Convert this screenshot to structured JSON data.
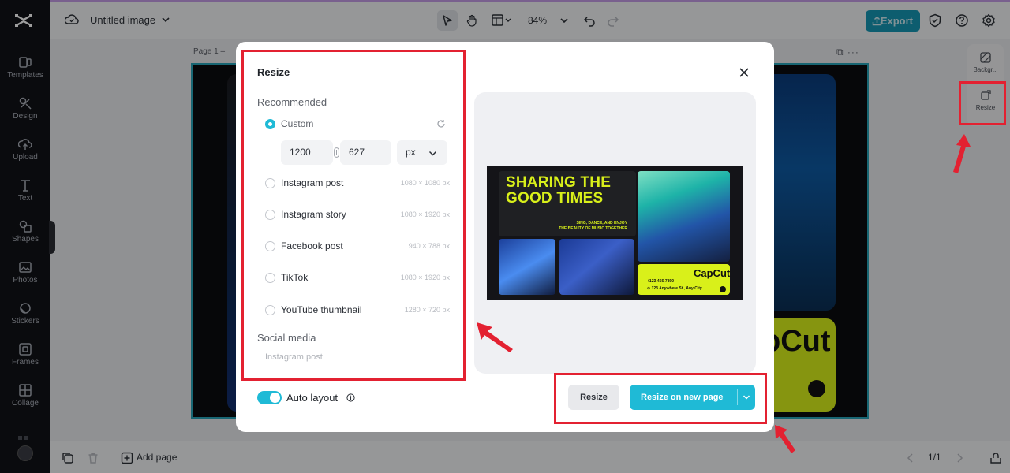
{
  "app": {
    "document_title": "Untitled image",
    "zoom": "84%",
    "export_label": "Export",
    "page_label": "Page 1 –",
    "page_options": "⧉ ···"
  },
  "sidebar": {
    "items": [
      {
        "label": "Templates",
        "icon": "templates-icon"
      },
      {
        "label": "Design",
        "icon": "design-icon"
      },
      {
        "label": "Upload",
        "icon": "upload-icon"
      },
      {
        "label": "Text",
        "icon": "text-icon"
      },
      {
        "label": "Shapes",
        "icon": "shapes-icon"
      },
      {
        "label": "Photos",
        "icon": "photos-icon"
      },
      {
        "label": "Stickers",
        "icon": "stickers-icon"
      },
      {
        "label": "Frames",
        "icon": "frames-icon"
      },
      {
        "label": "Collage",
        "icon": "collage-icon"
      }
    ]
  },
  "right_panel": {
    "items": [
      {
        "label": "Backgr...",
        "icon": "background-icon"
      },
      {
        "label": "Resize",
        "icon": "resize-icon"
      }
    ]
  },
  "bottom": {
    "add_page_label": "Add page",
    "page_count": "1/1"
  },
  "canvas_bg": {
    "brand": "pCut"
  },
  "modal": {
    "title": "Resize",
    "recommended_heading": "Recommended",
    "custom_label": "Custom",
    "width_value": "1200",
    "height_value": "627",
    "unit": "px",
    "options": [
      {
        "label": "Instagram post",
        "dims": "1080 × 1080 px"
      },
      {
        "label": "Instagram story",
        "dims": "1080 × 1920 px"
      },
      {
        "label": "Facebook post",
        "dims": "940 × 788 px"
      },
      {
        "label": "TikTok",
        "dims": "1080 × 1920 px"
      },
      {
        "label": "YouTube thumbnail",
        "dims": "1280 × 720 px"
      }
    ],
    "social_heading": "Social media",
    "social_first": "Instagram post",
    "auto_layout_label": "Auto layout",
    "auto_layout_on": true,
    "resize_button": "Resize",
    "resize_new_button": "Resize on new page",
    "preview": {
      "headline": "SHARING THE GOOD TIMES",
      "headline_line1": "SHARING THE",
      "headline_line2": "GOOD TIMES",
      "sub_line1": "SING, DANCE, AND ENJOY",
      "sub_line2": "THE BEAUTY OF MUSIC TOGETHER",
      "brand": "CapCut",
      "phone": "+123-456-7890",
      "address": "⊙ 123 Anywhere St., Any City"
    }
  },
  "colors": {
    "accent": "#1fbad6",
    "export_bg": "#1596b3",
    "sidebar_bg": "#111318",
    "highlight_red": "#e32131",
    "poster_yellow": "#d9f01a"
  }
}
